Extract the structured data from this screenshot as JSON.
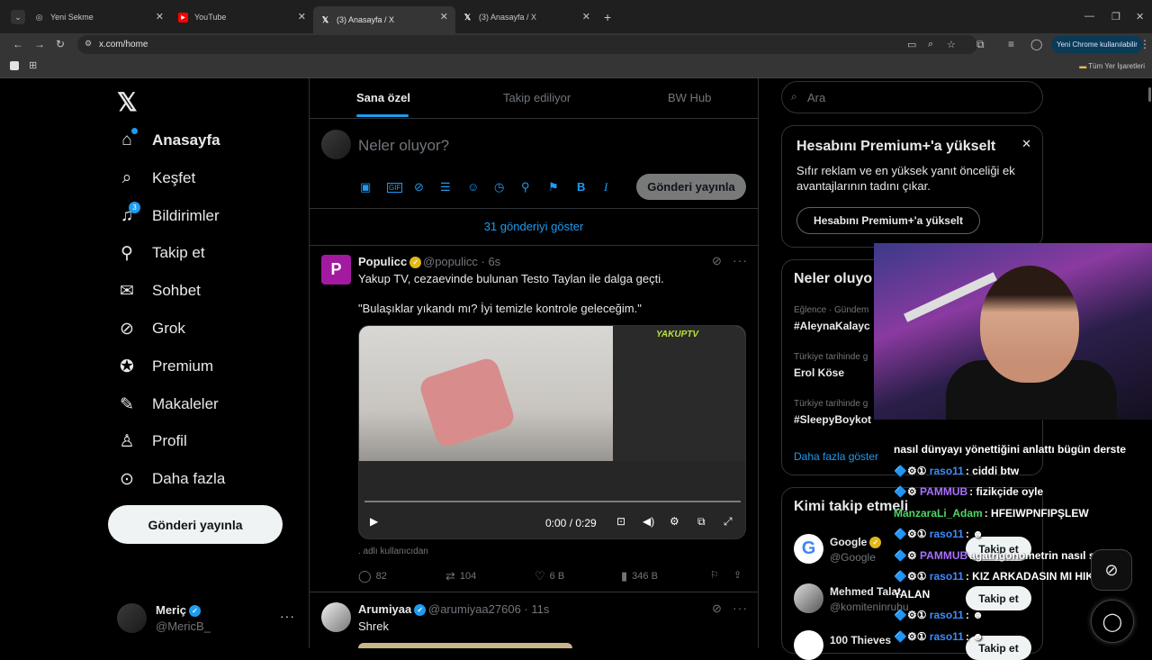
{
  "browser": {
    "tabs": [
      {
        "title": "Yeni Sekme",
        "icon": "chrome-icon"
      },
      {
        "title": "YouTube",
        "icon": "youtube-icon"
      },
      {
        "title": "(3) Anasayfa / X",
        "icon": "x-logo-icon"
      },
      {
        "title": "(3) Anasayfa / X",
        "icon": "x-logo-icon"
      }
    ],
    "url": "x.com/home",
    "profile_button": "Yeni Chrome kullanılabilir",
    "bookmarks_all": "Tüm Yer İşaretleri"
  },
  "nav": {
    "items": [
      {
        "label": "Anasayfa",
        "icon": "home-icon"
      },
      {
        "label": "Keşfet",
        "icon": "search-icon"
      },
      {
        "label": "Bildirimler",
        "icon": "bell-icon",
        "badge": "3"
      },
      {
        "label": "Takip et",
        "icon": "follow-icon"
      },
      {
        "label": "Sohbet",
        "icon": "mail-icon"
      },
      {
        "label": "Grok",
        "icon": "grok-icon"
      },
      {
        "label": "Premium",
        "icon": "premium-icon"
      },
      {
        "label": "Makaleler",
        "icon": "article-icon"
      },
      {
        "label": "Profil",
        "icon": "profile-icon"
      },
      {
        "label": "Daha fazla",
        "icon": "more-circle-icon"
      }
    ],
    "post_button": "Gönderi yayınla",
    "account": {
      "name": "Meriç",
      "handle": "@MericB_"
    }
  },
  "feed": {
    "tabs": [
      "Sana özel",
      "Takip ediliyor",
      "BW Hub"
    ],
    "compose_placeholder": "Neler oluyor?",
    "publish": "Gönderi yayınla",
    "show_more": "31 gönderiyi göster",
    "tweets": [
      {
        "name": "Populicc",
        "handle": "@populicc · 6s",
        "text1": "Yakup TV, cezaevinde bulunan Testo Taylan ile dalga geçti.",
        "text2": "\"Bulaşıklar yıkandı mı? İyi temizle kontrole geleceğim.\"",
        "video_time": "0:00 / 0:29",
        "video_logo": "YAKUPTV",
        "source": ". adlı kullanıcıdan",
        "replies": "82",
        "reposts": "104",
        "likes": "6 B",
        "views": "346 B"
      },
      {
        "name": "Arumiyaa",
        "handle": "@arumiyaa27606 · 11s",
        "text1": "Shrek"
      }
    ]
  },
  "sidebar": {
    "search_placeholder": "Ara",
    "premium": {
      "title": "Hesabını Premium+'a yükselt",
      "desc": "Sıfır reklam ve en yüksek yanıt önceliği ek avantajlarının tadını çıkar.",
      "button": "Hesabını Premium+'a yükselt"
    },
    "trends": {
      "title": "Neler oluyo",
      "items": [
        {
          "meta": "Eğlence · Gündem",
          "name": "#AleynaKalayc"
        },
        {
          "meta": "Türkiye tarihinde g",
          "name": "Erol Köse"
        },
        {
          "meta": "Türkiye tarihinde g",
          "name": "#SleepyBoykot"
        }
      ],
      "more": "Daha fazla göster"
    },
    "who": {
      "title": "Kimi takip etmeli",
      "items": [
        {
          "name": "Google",
          "handle": "@Google"
        },
        {
          "name": "Mehmed Talat",
          "handle": "@komiteninruhu"
        },
        {
          "name": "100 Thieves",
          "handle": ""
        }
      ],
      "follow": "Takip et"
    }
  },
  "stream_chat": [
    {
      "user": "",
      "msg": "nasıl dünyayı yönettiğini anlattı bügün derste",
      "color": "#ffffff"
    },
    {
      "user": "raso11",
      "msg": ": ciddi btw",
      "color": "#3c8cff"
    },
    {
      "user": "PAMMUB",
      "msg": ": fizikçide oyle",
      "color": "#a970ff"
    },
    {
      "user": "ManzaraLi_Adam",
      "msg": ": HFEIWPNFIPŞLEW",
      "color": "#4cd964"
    },
    {
      "user": "raso11",
      "msg": ":",
      "color": "#3c8cff"
    },
    {
      "user": "PAMMUB",
      "msg": "agatrigonometrin nasıl senin",
      "color": "#a970ff"
    },
    {
      "user": "raso11",
      "msg": ": KIZ ARKADASIN MI HIKAYE",
      "color": "#3c8cff"
    },
    {
      "user": "",
      "msg": "YALAN",
      "color": "#ffffff"
    },
    {
      "user": "raso11",
      "msg": ":",
      "color": "#3c8cff"
    },
    {
      "user": "raso11",
      "msg": ":",
      "color": "#3c8cff"
    }
  ]
}
